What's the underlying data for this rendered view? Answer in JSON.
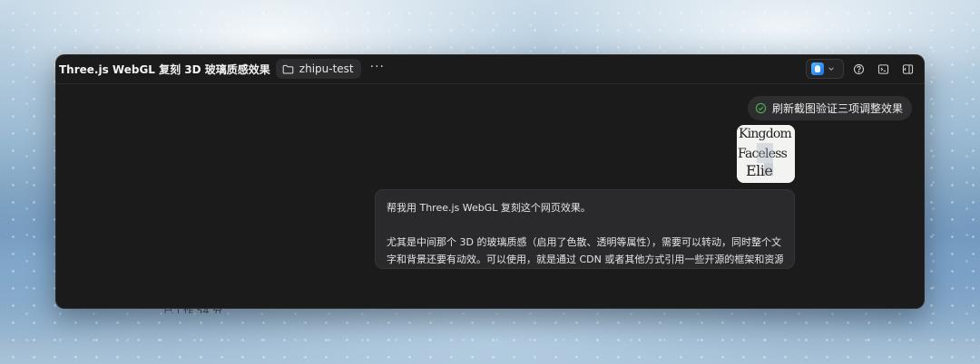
{
  "window": {
    "title": "Three.js WebGL 复刻 3D 玻璃质感效果",
    "folder": "zhipu-test",
    "more": "···"
  },
  "icons": {
    "folder": "folder-icon",
    "more": "ellipsis-icon",
    "app": "app-logo-icon",
    "chevron": "chevron-down-icon",
    "help": "help-circle-icon",
    "terminal": "terminal-icon",
    "panel": "sidebar-panel-icon",
    "check": "check-circle-icon"
  },
  "status_badge": {
    "label": "刷新截图验证三项调整效果"
  },
  "attachment": {
    "thumbnail_text": [
      "Kingdom",
      "Faceless",
      "Elie"
    ]
  },
  "user_message": {
    "line1": "帮我用 Three.js WebGL 复刻这个网页效果。",
    "line2": "尤其是中间那个 3D 的玻璃质感（启用了色散、透明等属性），需要可以转动，同时整个文",
    "line3": "字和背景还要有动效。可以使用，就是通过 CDN 或者其他方式引用一些开源的框架和资源"
  },
  "background_text": "已工作 54 分",
  "colors": {
    "window_bg": "#1b1b1c",
    "accent_check": "#4caf50",
    "bubble_bg": "#2a2a2c"
  }
}
